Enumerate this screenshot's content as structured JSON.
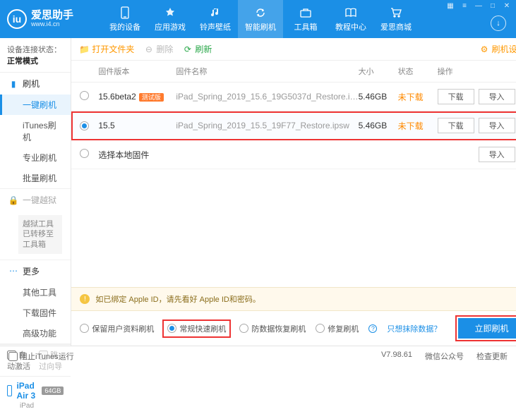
{
  "brand": {
    "name": "爱思助手",
    "url": "www.i4.cn"
  },
  "nav": [
    {
      "label": "我的设备"
    },
    {
      "label": "应用游戏"
    },
    {
      "label": "铃声壁纸"
    },
    {
      "label": "智能刷机"
    },
    {
      "label": "工具箱"
    },
    {
      "label": "教程中心"
    },
    {
      "label": "爱思商城"
    }
  ],
  "conn": {
    "label": "设备连接状态：",
    "value": "正常模式"
  },
  "groups": {
    "flash": {
      "title": "刷机",
      "items": [
        "一键刷机",
        "iTunes刷机",
        "专业刷机",
        "批量刷机"
      ]
    },
    "jail": {
      "title": "一键越狱",
      "note": "越狱工具已转移至工具箱"
    },
    "more": {
      "title": "更多",
      "items": [
        "其他工具",
        "下载固件",
        "高级功能"
      ]
    }
  },
  "sideopts": {
    "auto": "自动激活",
    "skip": "跳过向导"
  },
  "device": {
    "name": "iPad Air 3",
    "storage": "64GB",
    "type": "iPad"
  },
  "toolbar": {
    "open": "打开文件夹",
    "del": "删除",
    "refresh": "刷新",
    "settings": "刷机设置"
  },
  "cols": {
    "ver": "固件版本",
    "name": "固件名称",
    "size": "大小",
    "status": "状态",
    "ops": "操作"
  },
  "rows": [
    {
      "ver": "15.6beta2",
      "tag": "测试版",
      "name": "iPad_Spring_2019_15.6_19G5037d_Restore.i…",
      "size": "5.46GB",
      "status": "未下载"
    },
    {
      "ver": "15.5",
      "tag": "",
      "name": "iPad_Spring_2019_15.5_19F77_Restore.ipsw",
      "size": "5.46GB",
      "status": "未下载"
    }
  ],
  "localrow": "选择本地固件",
  "btns": {
    "dl": "下载",
    "imp": "导入"
  },
  "notice": "如已绑定 Apple ID，请先看好 Apple ID和密码。",
  "modes": {
    "m1": "保留用户资料刷机",
    "m2": "常规快速刷机",
    "m3": "防数据恢复刷机",
    "m4": "修复刷机",
    "link": "只想抹除数据？",
    "go": "立即刷机"
  },
  "footer": {
    "block": "阻止iTunes运行",
    "ver": "V7.98.61",
    "wx": "微信公众号",
    "upd": "检查更新"
  }
}
